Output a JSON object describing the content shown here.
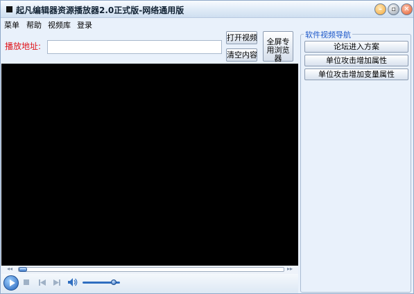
{
  "window": {
    "title": "起凡编辑器资源播放器2.0正式版-网络通用版",
    "controls": {
      "minimize_icon": "minimize-icon",
      "maximize_icon": "maximize-icon",
      "close_icon": "close-icon"
    }
  },
  "menu": {
    "items": [
      {
        "label": "菜单"
      },
      {
        "label": "帮助"
      },
      {
        "label": "视频库"
      },
      {
        "label": "登录"
      }
    ]
  },
  "address": {
    "label": "播放地址:",
    "value": "",
    "placeholder": ""
  },
  "buttons": {
    "open_video": "打开视频",
    "clear_content": "清空内容",
    "fullscreen_browser": "全屏专用浏览器"
  },
  "player": {
    "seek_progress": 0.0,
    "volume_level": 0.9,
    "icons": [
      "play-icon",
      "stop-icon",
      "previous-icon",
      "next-icon",
      "volume-icon",
      "seek-back-icon",
      "seek-forward-icon"
    ]
  },
  "nav": {
    "title": "软件视频导航",
    "items": [
      {
        "label": "论坛进入方案"
      },
      {
        "label": "单位攻击增加属性"
      },
      {
        "label": "单位攻击增加变量属性"
      }
    ]
  },
  "colors": {
    "address_label": "#e0141a",
    "nav_title": "#1a56c8",
    "video_bg": "#000000",
    "window_bg": "#e9f1fb"
  }
}
